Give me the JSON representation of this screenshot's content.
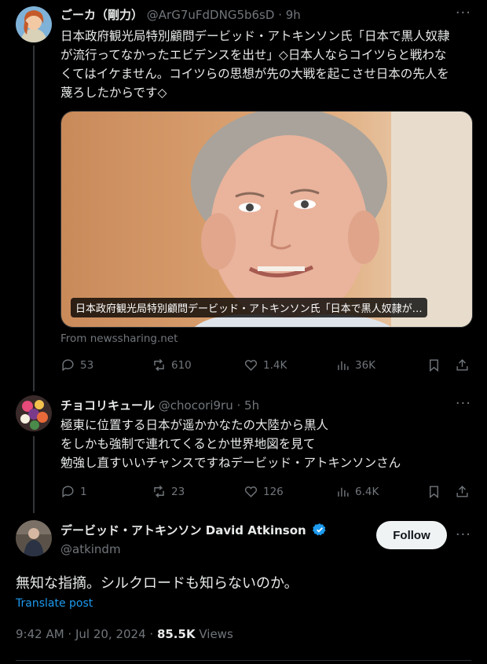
{
  "tweet1": {
    "name": "ごーカ（剛力）",
    "handle": "@ArG7uFdDNG5b6sD",
    "time": "9h",
    "more": "···",
    "lines": [
      "日本政府観光局特別顧問デービッド・アトキンソン氏「日本で黒人奴隷",
      "が流行ってなかったエビデンスを出せ」◇日本人ならコイツらと戦わな",
      "くてはイケません。コイツらの思想が先の大戦を起こさせ日本の先人を",
      "蔑ろしたからです◇"
    ],
    "card_caption": "日本政府観光局特別顧問デービッド・アトキンソン氏「日本で黒人奴隷が…",
    "source": "From newssharing.net",
    "replies": "53",
    "reposts": "610",
    "likes": "1.4K",
    "views": "36K"
  },
  "tweet2": {
    "name": "チョコリキュール",
    "handle": "@chocori9ru",
    "time": "5h",
    "more": "···",
    "lines": [
      "極東に位置する日本が遥かかなたの大陸から黒人",
      "をしかも強制で連れてくるとか世界地図を見て",
      "勉強し直すいいチャンスですねデービッド・アトキンソンさん"
    ],
    "replies": "1",
    "reposts": "23",
    "likes": "126",
    "views": "6.4K"
  },
  "tweet3": {
    "name": "デービッド・アトキンソン David Atkinson",
    "handle": "@atkindm",
    "follow_label": "Follow",
    "more": "···",
    "text": "無知な指摘。シルクロードも知らないのか。",
    "translate": "Translate post",
    "timestamp": "9:42 AM · Jul 20, 2024 · ",
    "view_count": "85.5K",
    "views_label": " Views"
  },
  "colors": {
    "background": "#000000",
    "text": "#e7e9ea",
    "muted": "#71767b",
    "accent": "#1d9bf0",
    "verified": "#1d9bf0"
  }
}
